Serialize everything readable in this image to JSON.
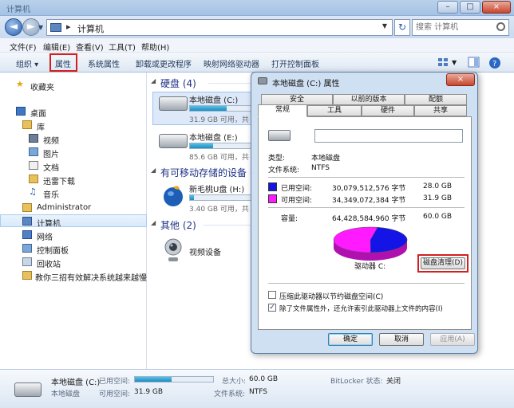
{
  "window": {
    "title": "计算机",
    "controls": [
      "–",
      "□",
      "×"
    ]
  },
  "address": {
    "path": "计算机",
    "search_placeholder": "搜索 计算机"
  },
  "menu": [
    "文件(F)",
    "编辑(E)",
    "查看(V)",
    "工具(T)",
    "帮助(H)"
  ],
  "toolbar": {
    "organize": "组织 ▾",
    "properties": "属性",
    "system_properties": "系统属性",
    "uninstall": "卸载或更改程序",
    "map_drive": "映射网络驱动器",
    "control_panel": "打开控制面板"
  },
  "nav": {
    "favorites": "收藏夹",
    "desktop": "桌面",
    "library": "库",
    "video": "视频",
    "pictures": "图片",
    "documents": "文档",
    "downloads": "迅雷下载",
    "music": "音乐",
    "admin": "Administrator",
    "computer": "计算机",
    "network": "网络",
    "control_panel": "控制面板",
    "recycle_bin": "回收站",
    "tutorial": "教你三招有效解决系统越来越慢的问"
  },
  "content": {
    "hdd_header": "硬盘 (4)",
    "removable_header": "有可移动存储的设备 (2",
    "other_header": "其他 (2)",
    "drives": [
      {
        "name": "本地磁盘 (C:)",
        "size": "31.9 GB 可用，共",
        "fill": 0.47
      },
      {
        "name": "本地磁盘 (E:)",
        "size": "85.6 GB 可用，共",
        "fill": 0.3
      },
      {
        "name": "新毛桃U盘 (H:)",
        "size": "3.40 GB 可用，共",
        "fill": 0.05
      }
    ],
    "video_device": "视频设备"
  },
  "status": {
    "name": "本地磁盘 (C:)",
    "type": "本地磁盘",
    "used_label": "已用空间:",
    "free_label": "可用空间:",
    "free_value": "31.9 GB",
    "total_label": "总大小:",
    "total_value": "60.0 GB",
    "fs_label": "文件系统:",
    "fs_value": "NTFS",
    "bitlocker_label": "BitLocker 状态:",
    "bitlocker_value": "关闭",
    "used_fraction": 0.47
  },
  "dialog": {
    "title": "本地磁盘 (C:) 属性",
    "close": "×",
    "tabs_row1": [
      "安全",
      "以前的版本",
      "配额"
    ],
    "tabs_row2": [
      "常规",
      "工具",
      "硬件",
      "共享"
    ],
    "type_label": "类型:",
    "type_value": "本地磁盘",
    "fs_label": "文件系统:",
    "fs_value": "NTFS",
    "used_label": "已用空间:",
    "used_bytes": "30,079,512,576 字节",
    "used_gb": "28.0 GB",
    "free_label": "可用空间:",
    "free_bytes": "34,349,072,384 字节",
    "free_gb": "31.9 GB",
    "capacity_label": "容量:",
    "capacity_bytes": "64,428,584,960 字节",
    "capacity_gb": "60.0 GB",
    "drive_label": "驱动器 C:",
    "cleanup": "磁盘清理(D)",
    "compress": "压缩此驱动器以节约磁盘空间(C)",
    "index": "除了文件属性外，还允许索引此驱动器上文件的内容(I)",
    "ok": "确定",
    "cancel": "取消",
    "apply": "应用(A)",
    "used_fraction": 0.467,
    "used_color": "#1414e6",
    "free_color": "#ff1aff"
  }
}
